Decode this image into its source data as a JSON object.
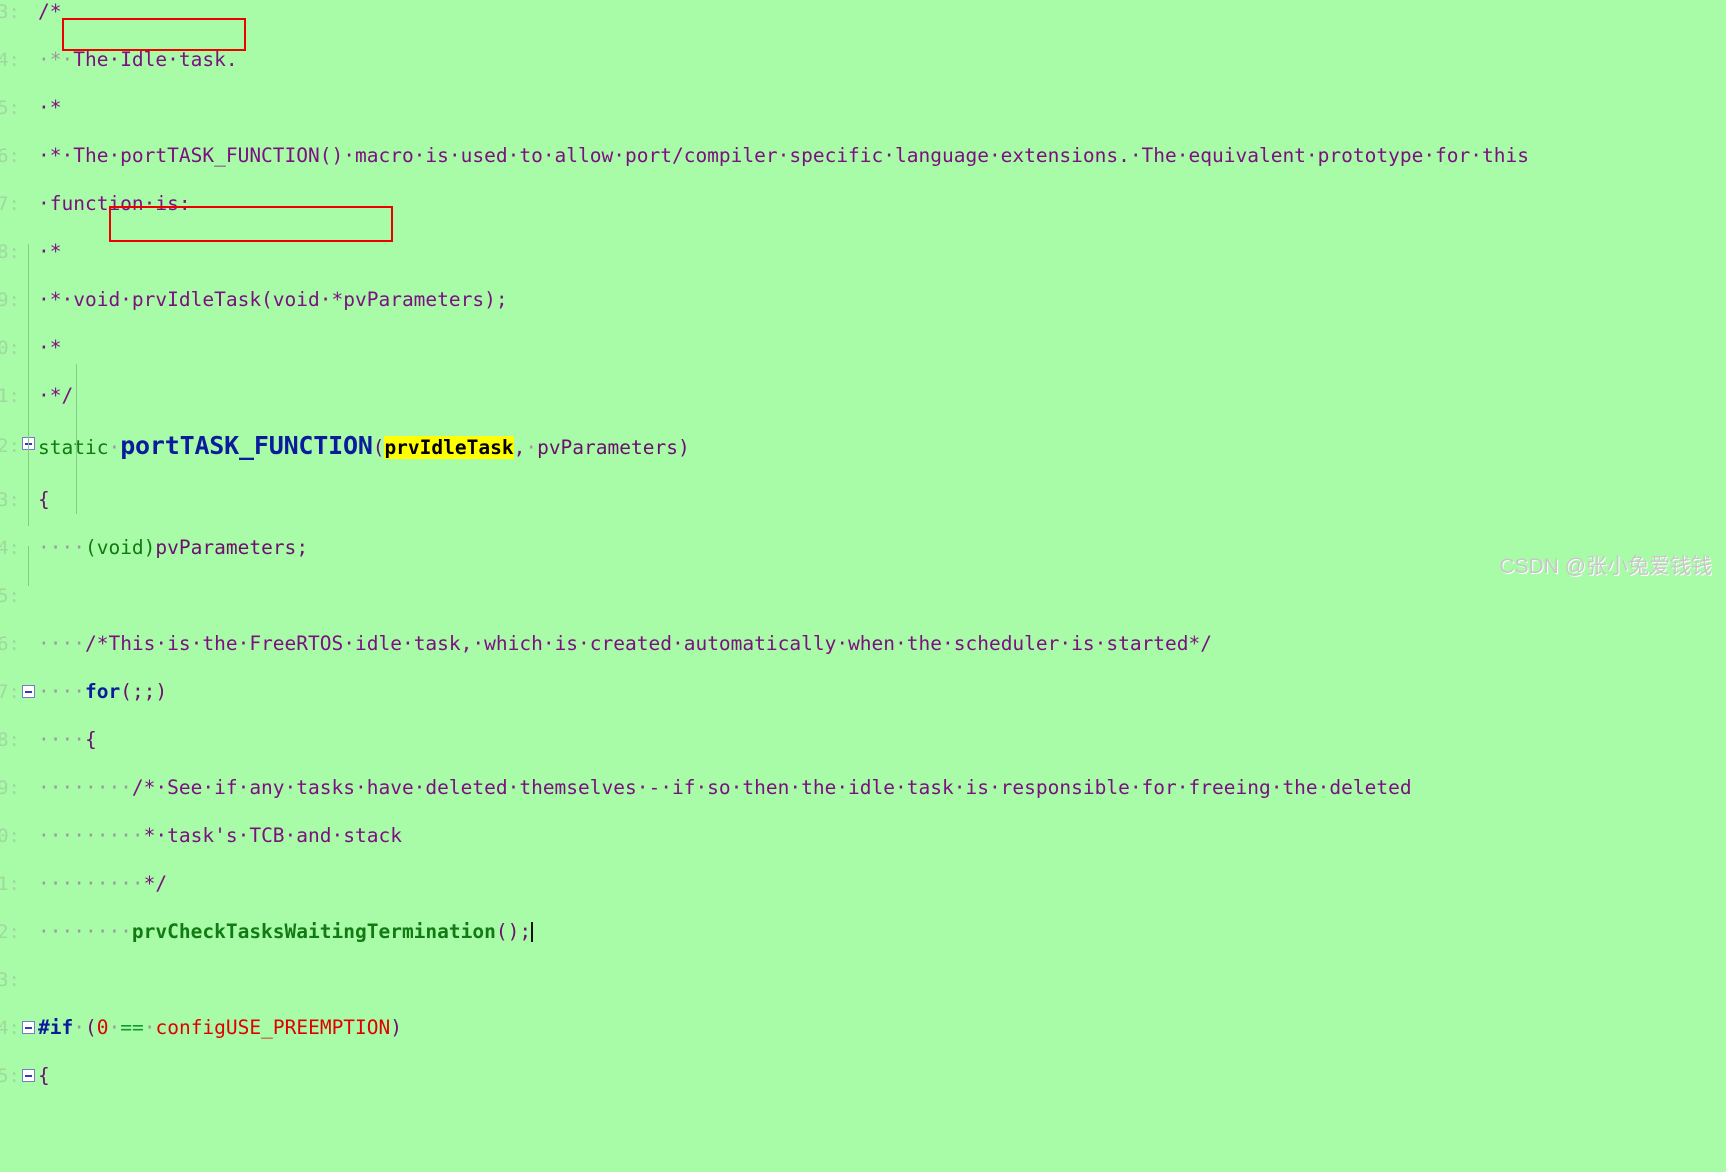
{
  "editor": {
    "background_color": "#a8fca8",
    "comment_color": "#7b1080",
    "keyword_color": "#0a1b9c",
    "identifier_color": "#127a12",
    "macro_color": "#e00000",
    "highlight_color": "#ffff00",
    "annotation_color": "#ee0000",
    "gutter_color": "#9fd9a0"
  },
  "gutter": {
    "line_numbers": [
      "3",
      "4",
      "5",
      "6",
      "7",
      "8",
      "9",
      "0",
      "1",
      "2",
      "3",
      "4",
      "5",
      "6",
      "7",
      "8",
      "9",
      "0",
      "1",
      "2",
      "3",
      "4",
      "5"
    ],
    "separator": ":"
  },
  "annotations": [
    {
      "name": "idle-task-box",
      "target_text": "The Idle task."
    },
    {
      "name": "porttask-function-box",
      "target_text": "portTASK_FUNCTION"
    }
  ],
  "highlight": {
    "text": "prvIdleTask",
    "color": "#ffff00"
  },
  "code": {
    "l3": {
      "text": "/*"
    },
    "l4": {
      "dots": "·*·",
      "text": "The·Idle·task."
    },
    "l5": {
      "text": "·*"
    },
    "l6": {
      "text": "·*·The·portTASK_FUNCTION()·macro·is·used·to·allow·port/compiler·specific·language·extensions.·The·equivalent·prototype·for·this"
    },
    "l7": {
      "text": "·function·is:"
    },
    "l8": {
      "text": "·*"
    },
    "l9": {
      "text": "·*·void·prvIdleTask(void·*pvParameters);"
    },
    "l10": {
      "text": "·*"
    },
    "l11": {
      "text": "·*/"
    },
    "l12": {
      "kw": "static",
      "sep": "·",
      "fn": "portTASK_FUNCTION",
      "open": "(",
      "arg1": "prvIdleTask",
      "comma": ",",
      "sp": "·",
      "arg2": "pvParameters",
      "close": ")"
    },
    "l13": {
      "text": "{"
    },
    "l14": {
      "dots": "····",
      "cast": "(void)",
      "id": "pvParameters",
      "semi": ";"
    },
    "l15": {
      "text": ""
    },
    "l16": {
      "dots": "····",
      "text": "/*This·is·the·FreeRTOS·idle·task,·which·is·created·automatically·when·the·scheduler·is·started*/"
    },
    "l17": {
      "dots": "····",
      "kw": "for",
      "rest": "(;;)"
    },
    "l18": {
      "dots": "····",
      "text": "{"
    },
    "l19": {
      "dots": "········",
      "text": "/*·See·if·any·tasks·have·deleted·themselves·-·if·so·then·the·idle·task·is·responsible·for·freeing·the·deleted"
    },
    "l20": {
      "dots": "·········",
      "text": "*·task's·TCB·and·stack"
    },
    "l21": {
      "dots": "·········",
      "text": "*/"
    },
    "l22": {
      "dots": "········",
      "fn": "prvCheckTasksWaitingTermination",
      "rest": "();"
    },
    "l23": {
      "text": ""
    },
    "l24": {
      "kw": "#if",
      "sp": "·",
      "p1": "(",
      "num": "0",
      "sp2": "·",
      "op": "==",
      "sp3": "·",
      "macro": "configUSE_PREEMPTION",
      "p2": ")"
    },
    "l25": {
      "text": "{"
    }
  },
  "watermark": {
    "text": "CSDN @张小兔爱钱钱"
  }
}
